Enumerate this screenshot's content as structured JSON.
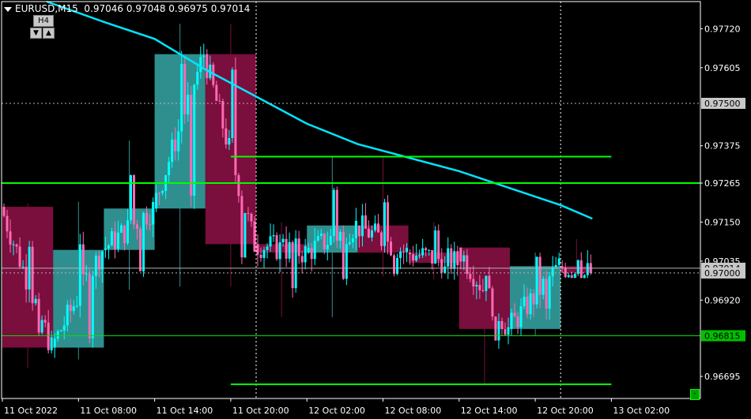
{
  "header": {
    "symbol": "EURUSD,M15",
    "ohlc": "0.97046 0.97048 0.96975 0.97014",
    "timeframe": "H4",
    "down_glyph": "▼",
    "up_glyph": "▲"
  },
  "corner_button": "-",
  "chart_data": {
    "type": "candlestick",
    "symbol": "EURUSD",
    "period": "M15",
    "ylim": [
      0.9663,
      0.978
    ],
    "y_ticks": [
      "0.97720",
      "0.97605",
      "0.97375",
      "0.97265",
      "0.97150",
      "0.97035",
      "0.96920",
      "0.96695"
    ],
    "x_ticks": [
      "11 Oct 2022",
      "11 Oct 08:00",
      "11 Oct 14:00",
      "11 Oct 20:00",
      "12 Oct 02:00",
      "12 Oct 08:00",
      "12 Oct 14:00",
      "12 Oct 20:00",
      "13 Oct 02:00"
    ],
    "price_levels": [
      {
        "label": "0.97500",
        "value": 0.975,
        "style": "dotted",
        "color": "#b4b4b4"
      },
      {
        "label": "0.97014",
        "value": 0.97014,
        "style": "solid",
        "color": "#b4b4b4"
      },
      {
        "label": "0.97000",
        "value": 0.97,
        "style": "dotted",
        "color": "#b4b4b4"
      },
      {
        "label": "0.96815",
        "value": 0.96815,
        "style": "solid",
        "color": "#00e000"
      }
    ],
    "horizontal_lines": [
      {
        "value": 0.97265,
        "color": "#00ff00",
        "width": 2
      },
      {
        "value": 0.97343,
        "color": "#00ff00",
        "width": 2,
        "from": "11 Oct 20:00",
        "to": "13 Oct 02:00"
      },
      {
        "value": 0.96672,
        "color": "#00ff00",
        "width": 2,
        "from": "11 Oct 20:00",
        "to": "13 Oct 02:00"
      }
    ],
    "h4_blocks": [
      {
        "open": 0.97195,
        "close": 0.9678,
        "high": 0.97205,
        "low": 0.9672,
        "start": 0.0,
        "end": 4.0
      },
      {
        "open": 0.9678,
        "close": 0.97068,
        "high": 0.9721,
        "low": 0.96745,
        "start": 4.0,
        "end": 8.0
      },
      {
        "open": 0.97068,
        "close": 0.9719,
        "high": 0.9739,
        "low": 0.9695,
        "start": 8.0,
        "end": 12.0
      },
      {
        "open": 0.9719,
        "close": 0.97645,
        "high": 0.97735,
        "low": 0.9696,
        "start": 12.0,
        "end": 16.0
      },
      {
        "open": 0.97645,
        "close": 0.97085,
        "high": 0.97735,
        "low": 0.9696,
        "start": 16.0,
        "end": 20.0
      },
      {
        "open": 0.97085,
        "close": 0.9706,
        "high": 0.9715,
        "low": 0.9687,
        "start": 20.0,
        "end": 24.0
      },
      {
        "open": 0.9706,
        "close": 0.9714,
        "high": 0.97343,
        "low": 0.9687,
        "start": 24.0,
        "end": 28.0
      },
      {
        "open": 0.9714,
        "close": 0.9706,
        "high": 0.97343,
        "low": 0.9699,
        "start": 28.0,
        "end": 32.0
      },
      {
        "open": 0.9706,
        "close": 0.9703,
        "high": 0.9715,
        "low": 0.9698,
        "start": 32.0,
        "end": 36.0
      },
      {
        "open": 0.97075,
        "close": 0.96835,
        "high": 0.97075,
        "low": 0.96672,
        "start": 36.0,
        "end": 40.0
      },
      {
        "open": 0.96835,
        "close": 0.9702,
        "high": 0.9706,
        "low": 0.96815,
        "start": 40.0,
        "end": 44.0
      },
      {
        "open": 0.9702,
        "close": 0.97,
        "high": 0.971,
        "low": 0.96985,
        "start": 44.0,
        "end": 46.5
      }
    ],
    "ma_slow": [
      [
        3.5,
        0.978
      ],
      [
        8,
        0.9774
      ],
      [
        12,
        0.9769
      ],
      [
        16,
        0.976
      ],
      [
        20,
        0.9752
      ],
      [
        24,
        0.9744
      ],
      [
        28,
        0.9738
      ],
      [
        32,
        0.9734
      ],
      [
        36,
        0.973
      ],
      [
        40,
        0.9725
      ],
      [
        44,
        0.972
      ],
      [
        46.5,
        0.9716
      ]
    ],
    "colors": {
      "bull": "#00ffff",
      "bear": "#ff69b4",
      "bull_block": "#2f8f8f",
      "bear_block": "#7a0e3c",
      "ma": "#00e5ff",
      "level": "#00ff00",
      "grid": "#ffffff",
      "axis_text": "#ffffff"
    }
  }
}
